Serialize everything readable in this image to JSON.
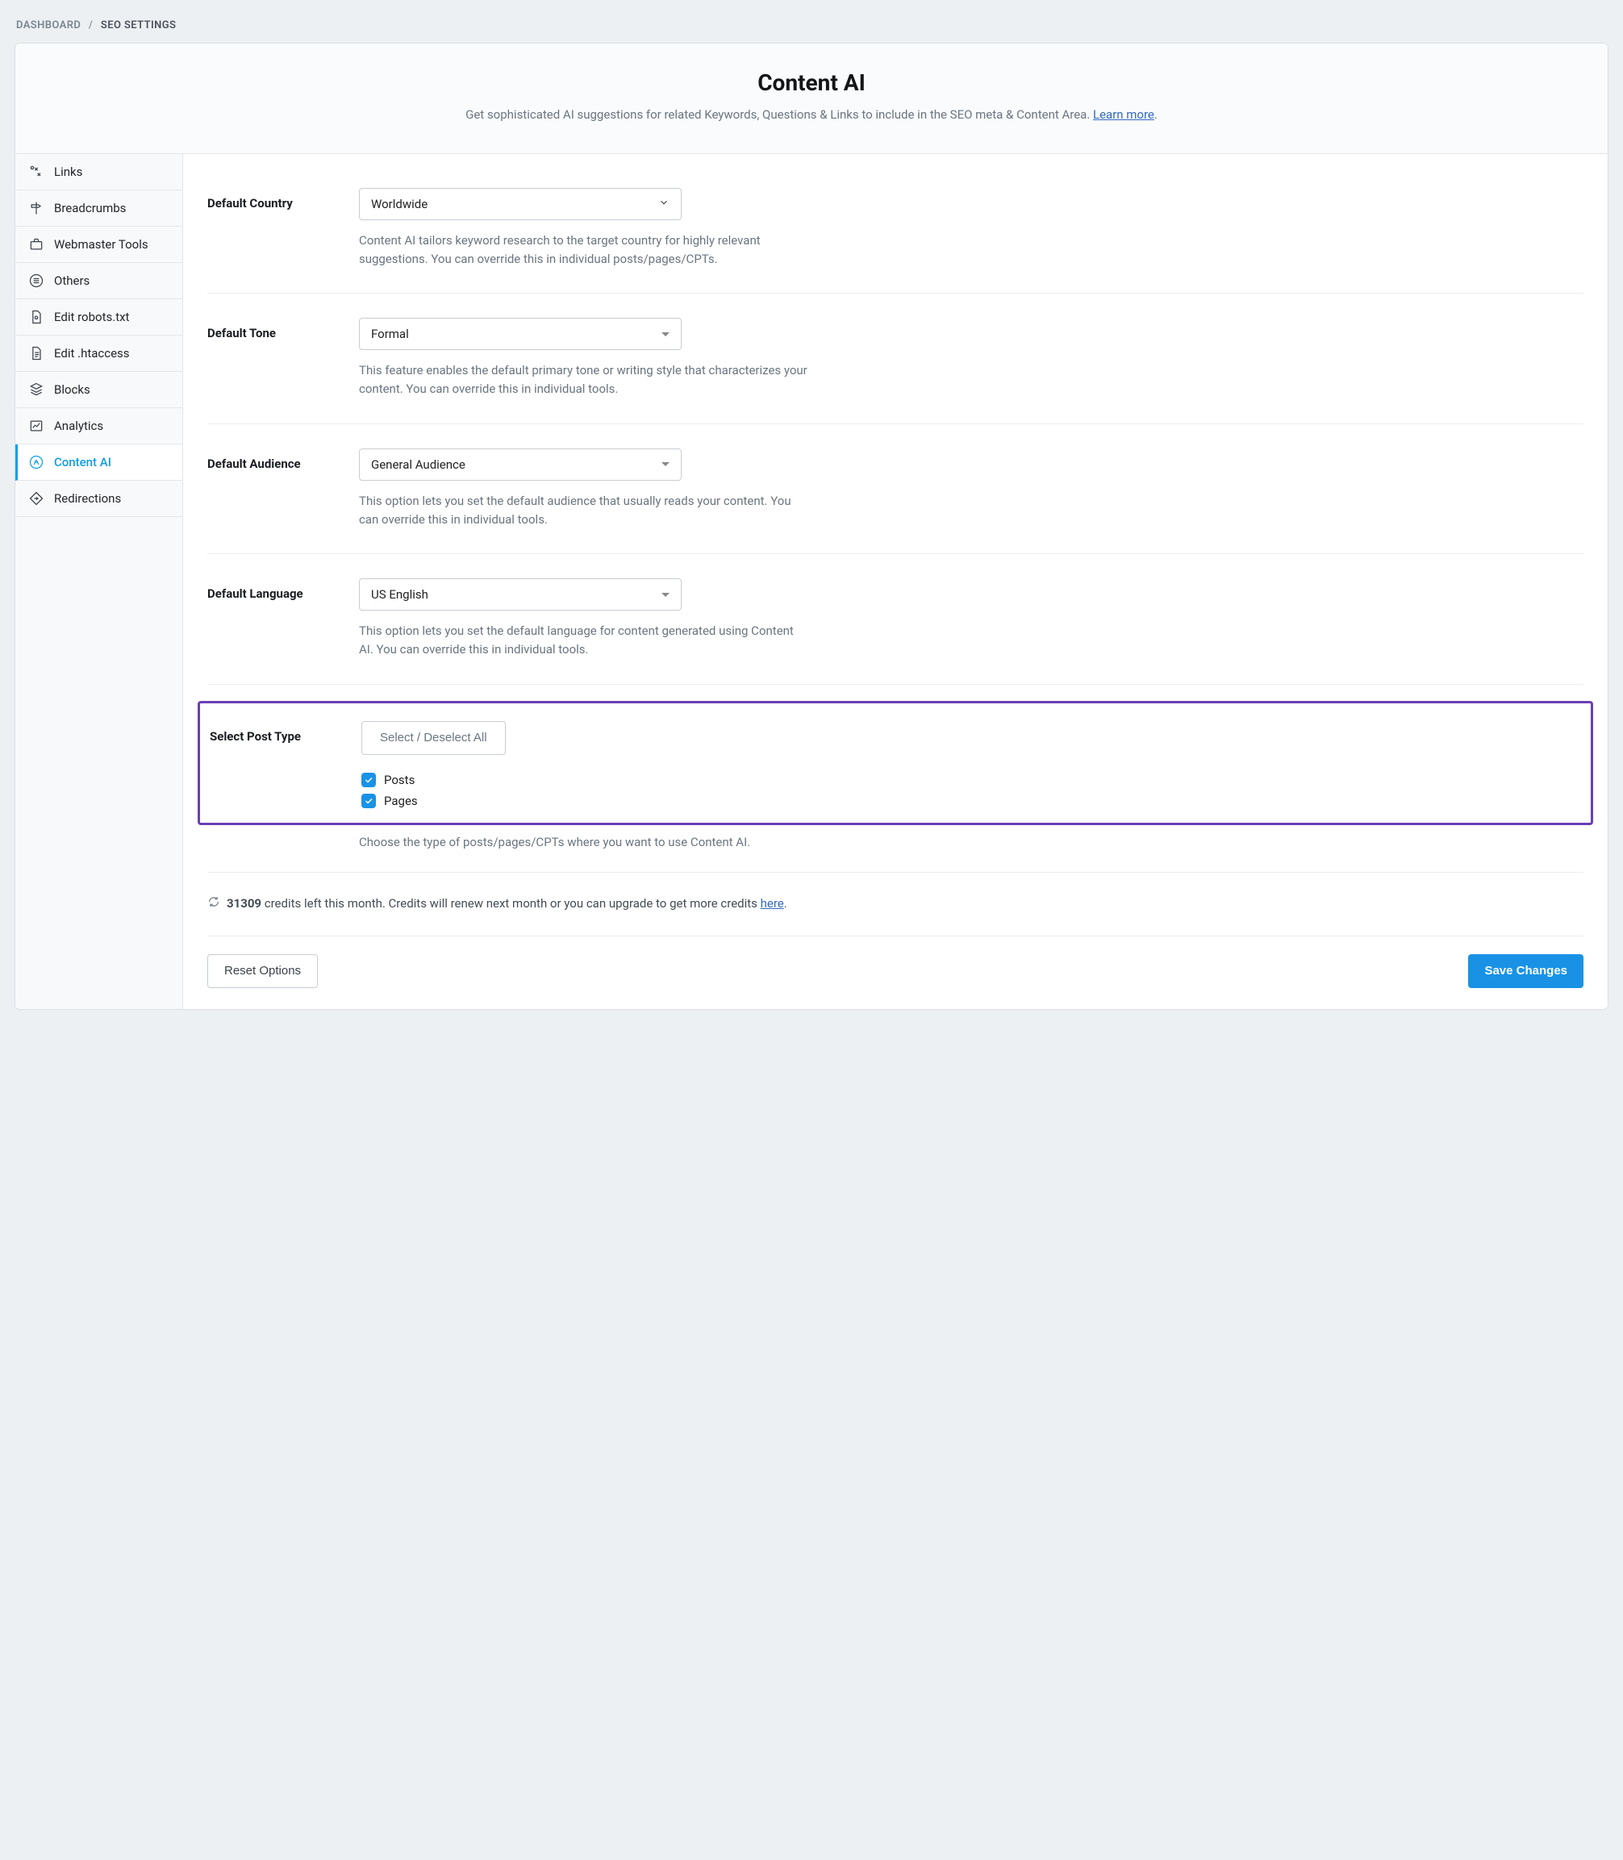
{
  "breadcrumb": {
    "root": "DASHBOARD",
    "current": "SEO SETTINGS"
  },
  "header": {
    "title": "Content AI",
    "subtitle_pre": "Get sophisticated AI suggestions for related Keywords, Questions & Links to include in the SEO meta & Content Area. ",
    "learn_more": "Learn more"
  },
  "sidebar": {
    "items": [
      {
        "label": "Links"
      },
      {
        "label": "Breadcrumbs"
      },
      {
        "label": "Webmaster Tools"
      },
      {
        "label": "Others"
      },
      {
        "label": "Edit robots.txt"
      },
      {
        "label": "Edit .htaccess"
      },
      {
        "label": "Blocks"
      },
      {
        "label": "Analytics"
      },
      {
        "label": "Content AI"
      },
      {
        "label": "Redirections"
      }
    ]
  },
  "fields": {
    "country": {
      "label": "Default Country",
      "value": "Worldwide",
      "help": "Content AI tailors keyword research to the target country for highly relevant suggestions. You can override this in individual posts/pages/CPTs."
    },
    "tone": {
      "label": "Default Tone",
      "value": "Formal",
      "help": "This feature enables the default primary tone or writing style that characterizes your content. You can override this in individual tools."
    },
    "audience": {
      "label": "Default Audience",
      "value": "General Audience",
      "help": "This option lets you set the default audience that usually reads your content. You can override this in individual tools."
    },
    "language": {
      "label": "Default Language",
      "value": "US English",
      "help": "This option lets you set the default language for content generated using Content AI. You can override this in individual tools."
    },
    "post_type": {
      "label": "Select Post Type",
      "toggle_all": "Select / Deselect All",
      "options": [
        {
          "label": "Posts",
          "checked": true
        },
        {
          "label": "Pages",
          "checked": true
        }
      ],
      "help": "Choose the type of posts/pages/CPTs where you want to use Content AI."
    }
  },
  "credits": {
    "count": "31309",
    "text_mid": " credits left this month. Credits will renew next month or you can upgrade to get more credits ",
    "link": "here"
  },
  "footer": {
    "reset": "Reset Options",
    "save": "Save Changes"
  }
}
